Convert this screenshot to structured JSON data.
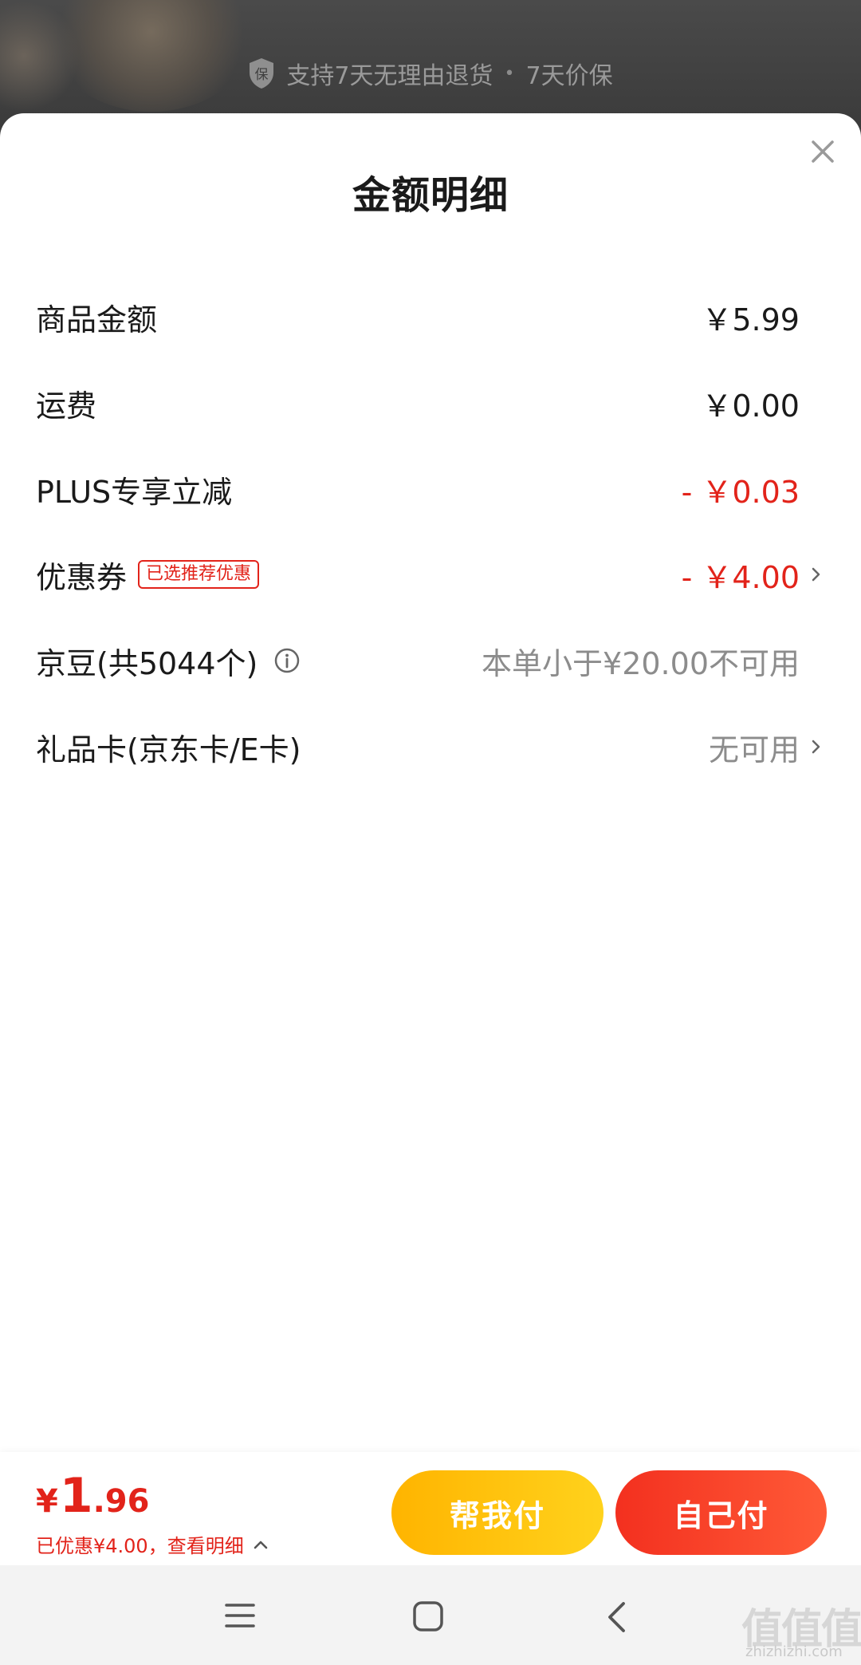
{
  "background": {
    "guarantee_icon_char": "保",
    "guarantee_text_1": "支持7天无理由退货",
    "guarantee_sep": "•",
    "guarantee_text_2": "7天价保"
  },
  "sheet": {
    "title": "金额明细",
    "rows": [
      {
        "label": "商品金额",
        "value": "￥5.99",
        "tone": "normal"
      },
      {
        "label": "运费",
        "value": "￥0.00",
        "tone": "normal"
      },
      {
        "label": "PLUS专享立减",
        "value": "- ￥0.03",
        "tone": "red"
      },
      {
        "label": "优惠券",
        "tag": "已选推荐优惠",
        "value": "- ￥4.00",
        "tone": "red"
      },
      {
        "label": "京豆(共5044个)",
        "value": "本单小于¥20.00不可用",
        "tone": "grey"
      },
      {
        "label": "礼品卡(京东卡/E卡)",
        "value": "无可用",
        "tone": "grey"
      }
    ]
  },
  "footer": {
    "total_symbol": "¥",
    "total_int": "1",
    "total_dec": ".96",
    "discount_text": "已优惠¥4.00，查看明细",
    "help_pay_label": "帮我付",
    "self_pay_label": "自己付"
  },
  "watermark": {
    "main": "值值值",
    "sub": "zhizhizhi.com"
  },
  "colors": {
    "accent_red": "#e2231a",
    "help_btn": "#ffc107",
    "self_btn": "#f63f27"
  }
}
